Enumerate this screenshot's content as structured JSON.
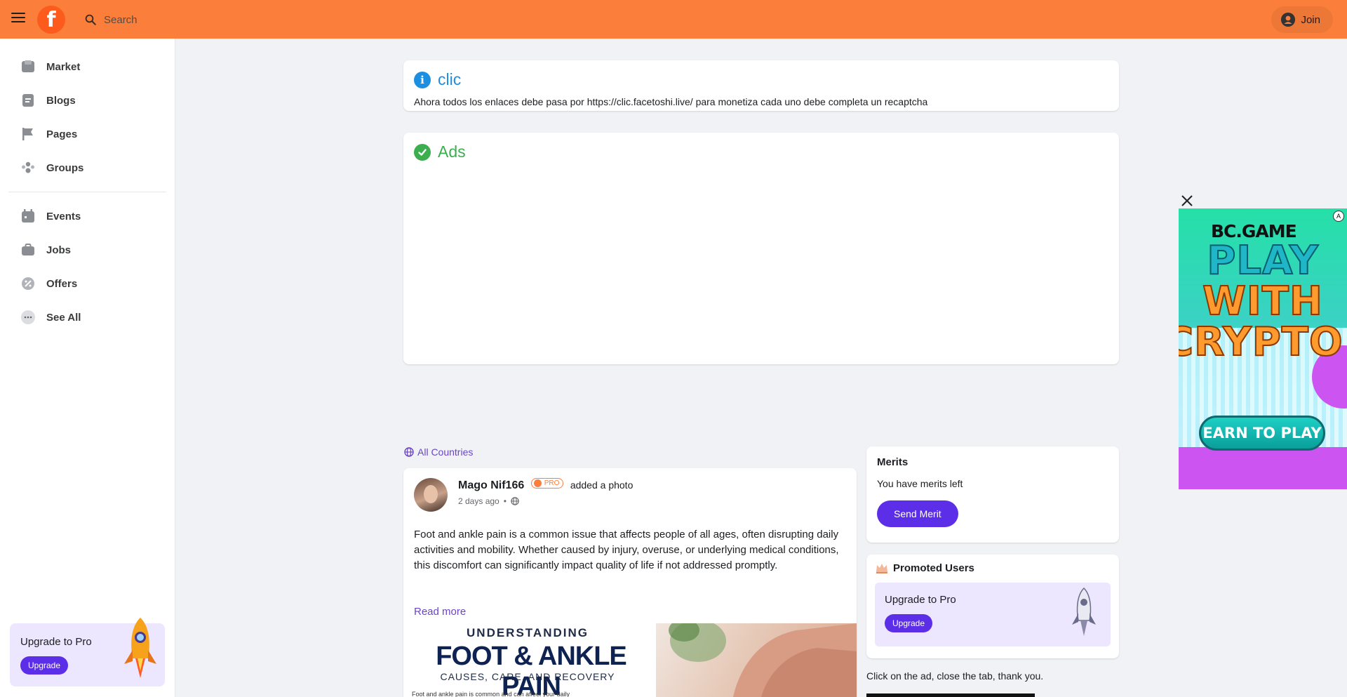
{
  "header": {
    "search_placeholder": "Search",
    "join_label": "Join",
    "brand_color": "#fb7f3b"
  },
  "sidebar": {
    "items": [
      {
        "label": "Market",
        "icon": "market-icon"
      },
      {
        "label": "Blogs",
        "icon": "blogs-icon"
      },
      {
        "label": "Pages",
        "icon": "flag-icon"
      },
      {
        "label": "Groups",
        "icon": "groups-icon"
      },
      {
        "label": "Events",
        "icon": "calendar-icon"
      },
      {
        "label": "Jobs",
        "icon": "briefcase-icon"
      },
      {
        "label": "Offers",
        "icon": "offer-icon"
      },
      {
        "label": "See All",
        "icon": "more-icon"
      }
    ],
    "pro_card": {
      "title": "Upgrade to Pro",
      "button": "Upgrade"
    }
  },
  "announcements": [
    {
      "title": "clic",
      "text": "Ahora todos los enlaces debe pasa por https://clic.facetoshi.live/ para monetiza cada uno debe completa un recaptcha",
      "color": "#1d8fe0"
    },
    {
      "title": "Ads",
      "color": "#3cae4e"
    }
  ],
  "feed": {
    "filter_label": "All Countries",
    "post": {
      "author": "Mago Nif166",
      "badge": "PRO",
      "action": "added a photo",
      "time": "2 days ago",
      "body": "Foot and ankle pain is a common issue that affects people of all ages, often disrupting daily activities and mobility. Whether caused by injury, overuse, or underlying medical conditions, this discomfort can significantly impact quality of life if not addressed promptly.",
      "read_more": "Read more",
      "image": {
        "line1": "UNDERSTANDING",
        "title": "FOOT & ANKLE PAIN",
        "line2": "CAUSES, CARE, AND RECOVERY",
        "small": "Foot and ankle pain is common and can affect your daily"
      }
    }
  },
  "right_panel": {
    "merits": {
      "title": "Merits",
      "text": "You have merits left",
      "button": "Send Merit"
    },
    "promoted": {
      "title": "Promoted Users",
      "box_title": "Upgrade to Pro",
      "button": "Upgrade"
    },
    "note": "Click on the ad, close the tab, thank you."
  },
  "ad": {
    "logo": "BC.GAME",
    "line1": "PLAY",
    "line2": "WITH",
    "line3": "CRYPTO",
    "cta": "EARN TO PLAY"
  }
}
